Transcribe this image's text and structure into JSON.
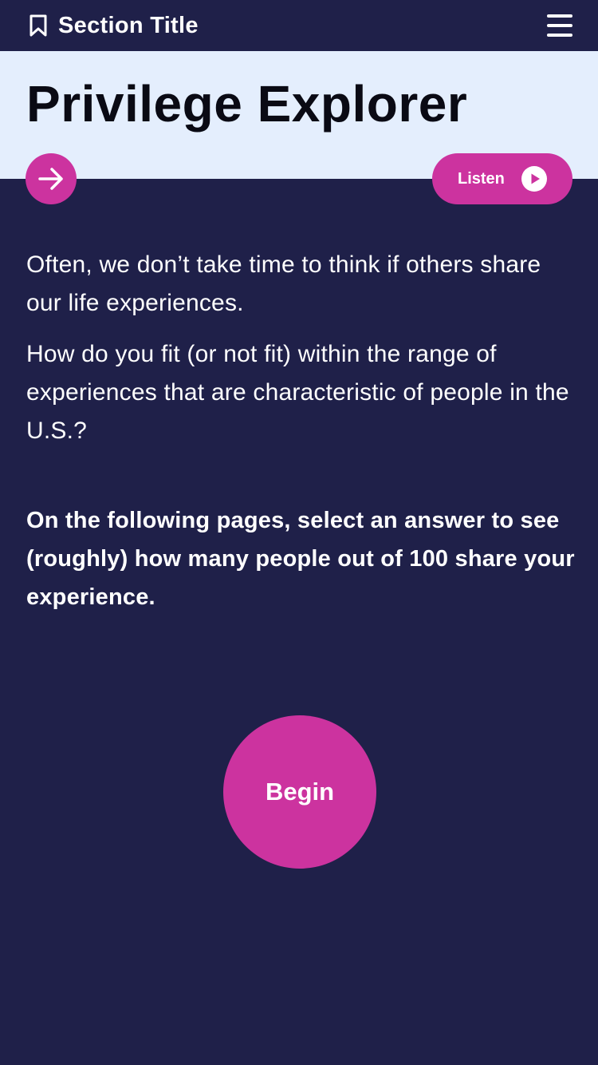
{
  "header": {
    "section_title": "Section Title",
    "bookmark_icon": "bookmark-icon",
    "menu_icon": "hamburger-menu-icon"
  },
  "hero": {
    "title": "Privilege Explorer",
    "next_icon": "arrow-right-icon",
    "listen_label": "Listen",
    "listen_icon": "play-icon"
  },
  "body": {
    "paragraphs": [
      "Often, we don’t take time to think if others share our life experiences.",
      "How do you fit (or not fit) within the range of experiences that are characteristic of people in the U.S.?"
    ],
    "instruction": "On the following pages, select an answer to see (roughly) how many people out of 100 share your experience."
  },
  "cta": {
    "begin_label": "Begin"
  },
  "colors": {
    "background": "#1f2049",
    "hero_background": "#e4eefd",
    "accent": "#cc339f",
    "text_light": "#ffffff",
    "text_dark": "#0a0a14"
  }
}
